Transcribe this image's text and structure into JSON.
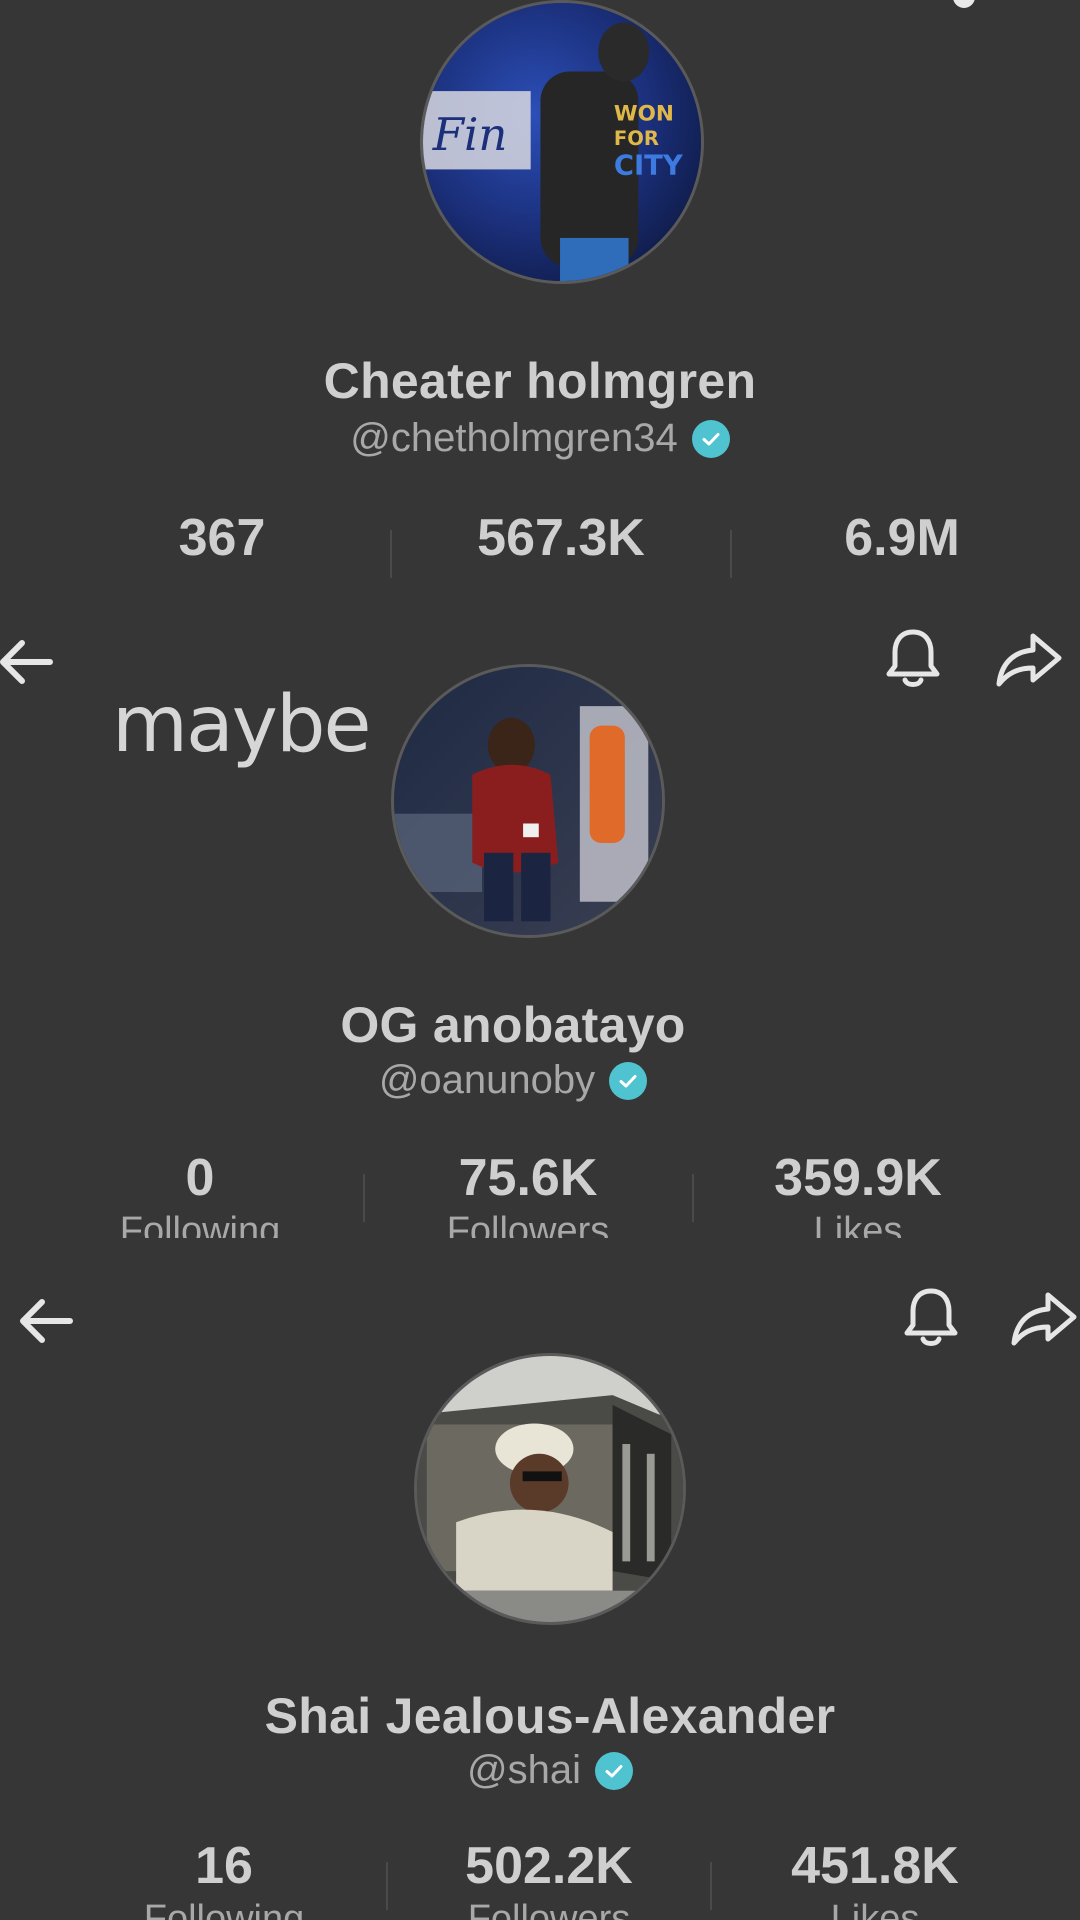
{
  "overlay_text": "maybe",
  "profiles": [
    {
      "name": "Cheater holmgren",
      "handle": "@chetholmgren34",
      "stats": [
        {
          "value": "367",
          "label": ""
        },
        {
          "value": "567.3K",
          "label": ""
        },
        {
          "value": "6.9M",
          "label": ""
        }
      ]
    },
    {
      "name": "OG anobatayo",
      "handle": "@oanunoby",
      "stats": [
        {
          "value": "0",
          "label": "Following"
        },
        {
          "value": "75.6K",
          "label": "Followers"
        },
        {
          "value": "359.9K",
          "label": "Likes"
        }
      ]
    },
    {
      "name": "Shai Jealous-Alexander",
      "handle": "@shai",
      "stats": [
        {
          "value": "16",
          "label": "Following"
        },
        {
          "value": "502.2K",
          "label": "Followers"
        },
        {
          "value": "451.8K",
          "label": "Likes"
        }
      ]
    }
  ],
  "icons": {
    "back": "arrow-left-icon",
    "notify": "bell-icon",
    "share": "share-arrow-icon",
    "verified": "verified-check-icon"
  },
  "colors": {
    "background": "#363636",
    "verified": "#4fc3cf",
    "text_primary": "#cfcfcf",
    "text_secondary": "#a8a8a8"
  }
}
